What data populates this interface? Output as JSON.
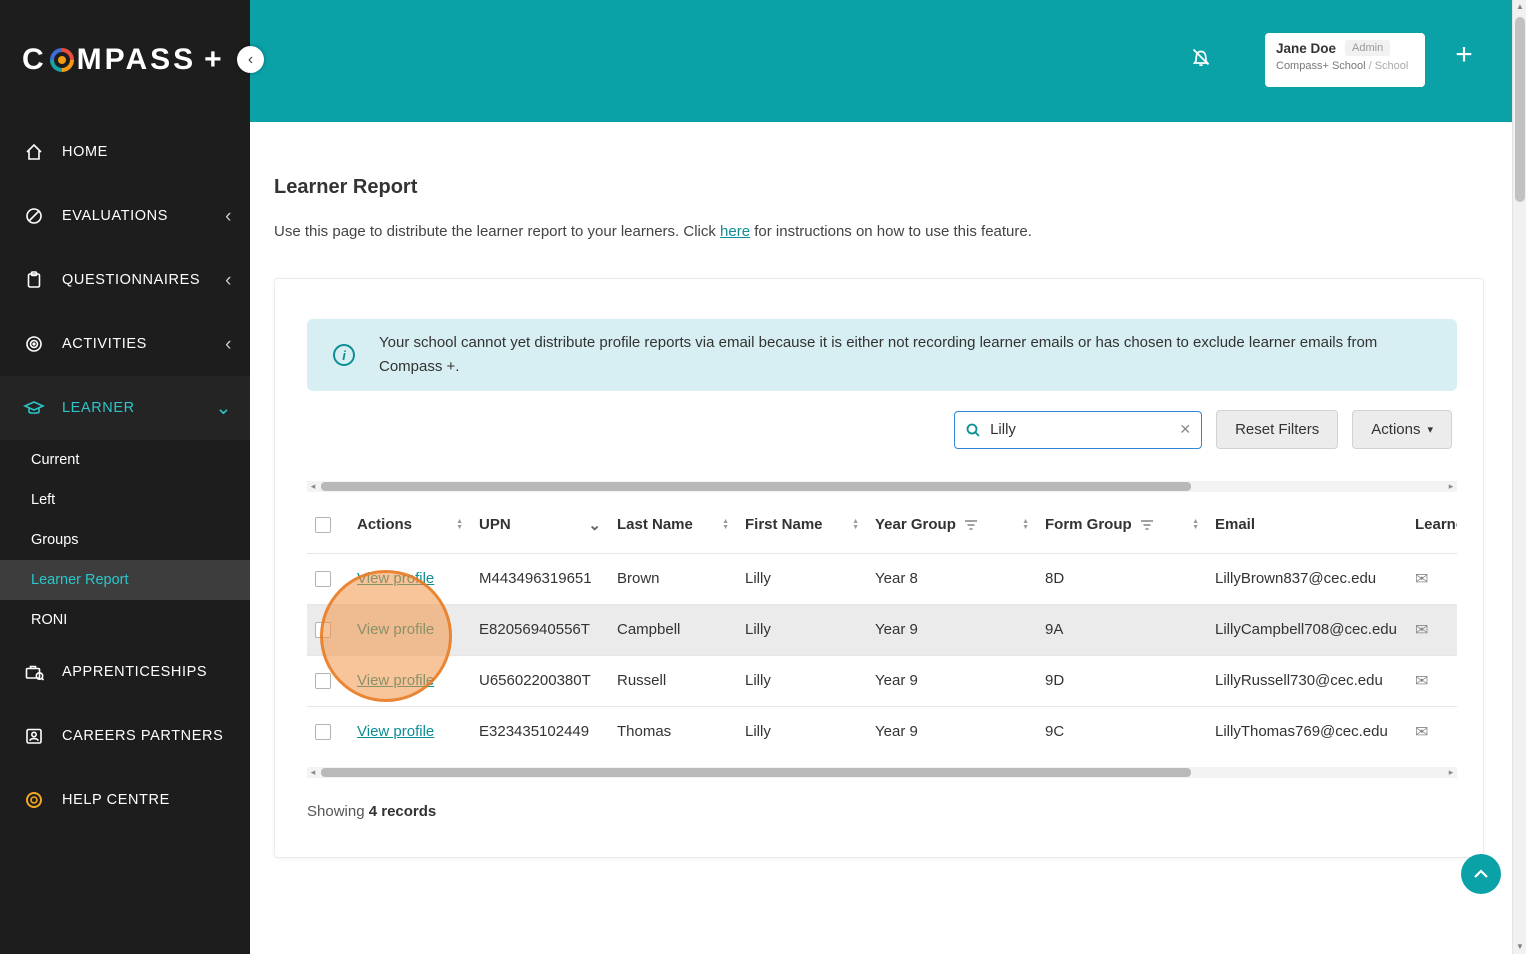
{
  "colors": {
    "brand_teal": "#0aa2a7",
    "sidebar_bg": "#1d1d1d",
    "link_teal": "#0d8e94",
    "alert_bg": "#d7eef2",
    "active_subitem_teal": "#2cc5c9",
    "click_indicator_orange": "#f09446"
  },
  "icons": {
    "collapse": "‹",
    "chevron_collapsed": "‹",
    "chevron_expanded": "⌄",
    "sort_asc": "▲",
    "sort_desc": "▼",
    "sorted_down": "⌄",
    "clear": "✕",
    "caret_down": "▾",
    "envelope": "✉",
    "plus": "+",
    "info": "i",
    "scroll_left": "◂",
    "scroll_right": "▸",
    "scroll_up": "▲",
    "scroll_down": "▼"
  },
  "sidebar": {
    "logo_c": "C",
    "logo_rest": "MPASS",
    "logo_plus": "+",
    "items": [
      {
        "label": "HOME"
      },
      {
        "label": "EVALUATIONS"
      },
      {
        "label": "QUESTIONNAIRES"
      },
      {
        "label": "ACTIVITIES"
      },
      {
        "label": "LEARNER"
      },
      {
        "label": "APPRENTICESHIPS"
      },
      {
        "label": "CAREERS PARTNERS"
      },
      {
        "label": "HELP CENTRE"
      }
    ],
    "learner_subitems": [
      {
        "label": "Current",
        "active": false
      },
      {
        "label": "Left",
        "active": false
      },
      {
        "label": "Groups",
        "active": false
      },
      {
        "label": "Learner Report",
        "active": true
      },
      {
        "label": "RONI",
        "active": false
      }
    ]
  },
  "header": {
    "user_name": "Jane Doe",
    "user_role": "Admin",
    "org": "Compass+ School",
    "org_sub": "/ School"
  },
  "page": {
    "title": "Learner Report",
    "desc_before": "Use this page to distribute the learner report to your learners. Click ",
    "desc_link": "here",
    "desc_after": " for instructions on how to use this feature.",
    "alert_text": "Your school cannot yet distribute profile reports via email because it is either not recording learner emails or has chosen to exclude learner emails from Compass +.",
    "showing_label": "Showing ",
    "records_text": "4 records"
  },
  "filters": {
    "search_value": "Lilly",
    "reset_label": "Reset Filters",
    "actions_label": "Actions"
  },
  "table": {
    "columns": [
      "Actions",
      "UPN",
      "Last Name",
      "First Name",
      "Year Group",
      "Form Group",
      "Email",
      "Learner"
    ],
    "rows": [
      {
        "action": "View profile",
        "upn": "M443496319651",
        "last": "Brown",
        "first": "Lilly",
        "year": "Year 8",
        "form": "8D",
        "email": "LillyBrown837@cec.edu"
      },
      {
        "action": "View profile",
        "upn": "E82056940556T",
        "last": "Campbell",
        "first": "Lilly",
        "year": "Year 9",
        "form": "9A",
        "email": "LillyCampbell708@cec.edu"
      },
      {
        "action": "View profile",
        "upn": "U65602200380T",
        "last": "Russell",
        "first": "Lilly",
        "year": "Year 9",
        "form": "9D",
        "email": "LillyRussell730@cec.edu"
      },
      {
        "action": "View profile",
        "upn": "E323435102449",
        "last": "Thomas",
        "first": "Lilly",
        "year": "Year 9",
        "form": "9C",
        "email": "LillyThomas769@cec.edu"
      }
    ]
  }
}
